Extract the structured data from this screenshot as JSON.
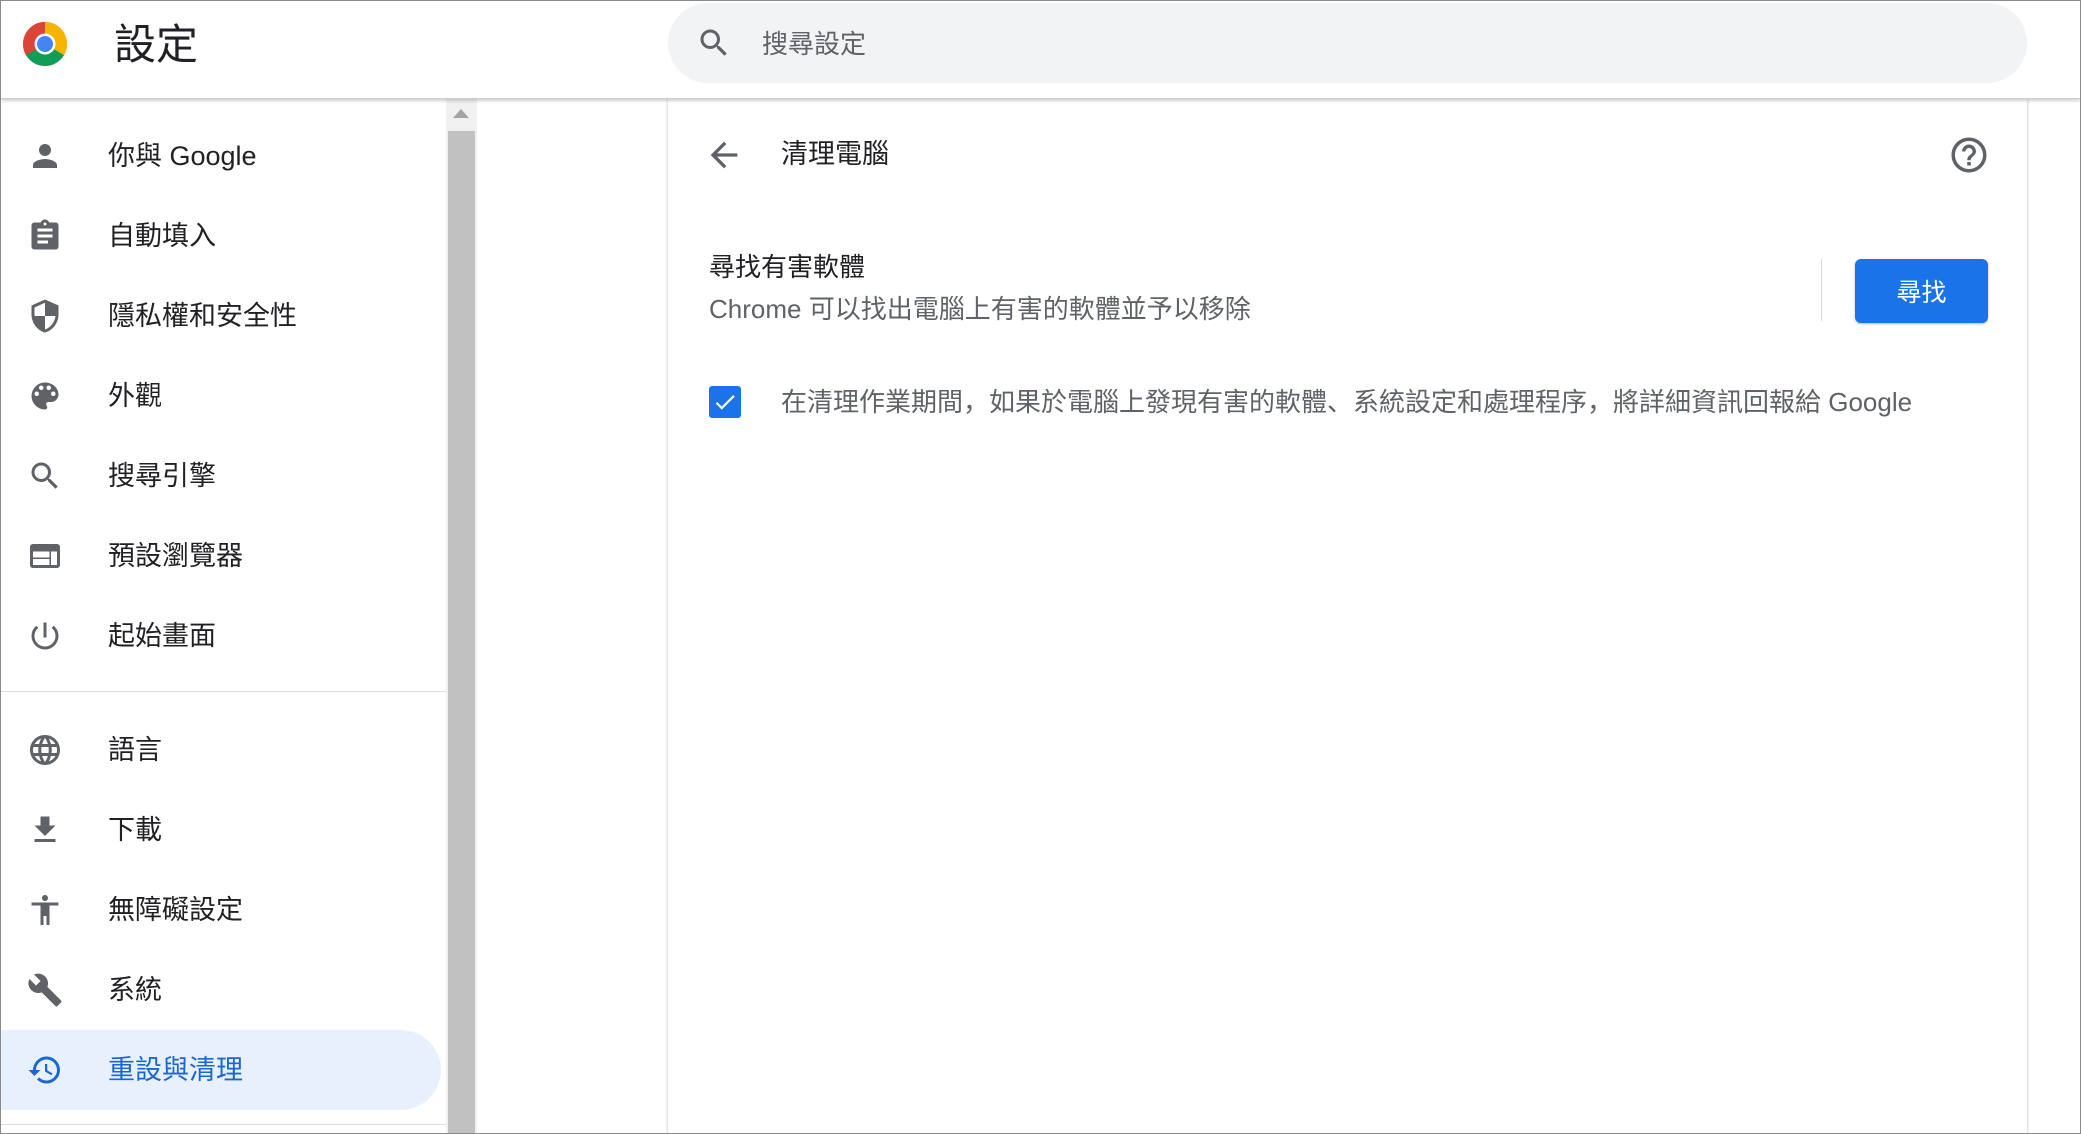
{
  "header": {
    "title": "設定",
    "search_placeholder": "搜尋設定"
  },
  "sidebar": {
    "items": [
      {
        "label": "你與 Google",
        "icon": "person-icon"
      },
      {
        "label": "自動填入",
        "icon": "clipboard-icon"
      },
      {
        "label": "隱私權和安全性",
        "icon": "shield-icon"
      },
      {
        "label": "外觀",
        "icon": "palette-icon"
      },
      {
        "label": "搜尋引擎",
        "icon": "search-icon"
      },
      {
        "label": "預設瀏覽器",
        "icon": "browser-icon"
      },
      {
        "label": "起始畫面",
        "icon": "power-icon"
      },
      {
        "label": "語言",
        "icon": "globe-icon"
      },
      {
        "label": "下載",
        "icon": "download-icon"
      },
      {
        "label": "無障礙設定",
        "icon": "accessibility-icon"
      },
      {
        "label": "系統",
        "icon": "wrench-icon"
      },
      {
        "label": "重設與清理",
        "icon": "history-icon",
        "active": true
      }
    ]
  },
  "main": {
    "page_title": "清理電腦",
    "section_title": "尋找有害軟體",
    "section_desc": "Chrome 可以找出電腦上有害的軟體並予以移除",
    "find_button": "尋找",
    "checkbox_checked": true,
    "checkbox_label": "在清理作業期間，如果於電腦上發現有害的軟體、系統設定和處理程序，將詳細資訊回報給 Google"
  },
  "colors": {
    "accent": "#1a73e8",
    "active_bg": "#e8f0fe",
    "active_text": "#1967d2",
    "icon": "#5f6368"
  }
}
